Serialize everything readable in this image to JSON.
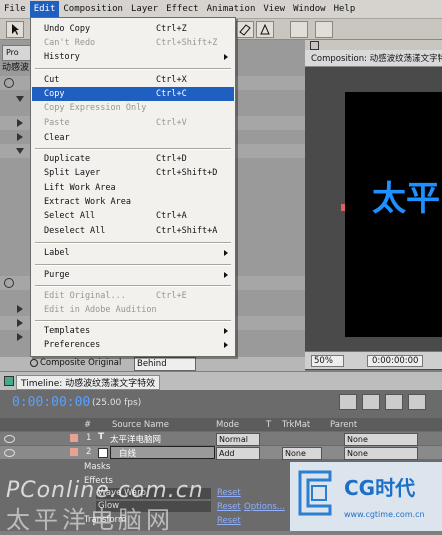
{
  "menubar": [
    "File",
    "Edit",
    "Composition",
    "Layer",
    "Effect",
    "Animation",
    "View",
    "Window",
    "Help"
  ],
  "edit_menu": [
    {
      "label": "Undo Copy",
      "shortcut": "Ctrl+Z",
      "state": "enabled"
    },
    {
      "label": "Can't Redo",
      "shortcut": "Ctrl+Shift+Z",
      "state": "disabled"
    },
    {
      "label": "History",
      "shortcut": "",
      "state": "submenu"
    },
    {
      "label": "Cut",
      "shortcut": "Ctrl+X",
      "state": "enabled"
    },
    {
      "label": "Copy",
      "shortcut": "Ctrl+C",
      "state": "highlighted"
    },
    {
      "label": "Copy Expression Only",
      "shortcut": "",
      "state": "disabled"
    },
    {
      "label": "Paste",
      "shortcut": "Ctrl+V",
      "state": "disabled"
    },
    {
      "label": "Clear",
      "shortcut": "",
      "state": "enabled"
    },
    {
      "label": "Duplicate",
      "shortcut": "Ctrl+D",
      "state": "enabled"
    },
    {
      "label": "Split Layer",
      "shortcut": "Ctrl+Shift+D",
      "state": "enabled"
    },
    {
      "label": "Lift Work Area",
      "shortcut": "",
      "state": "enabled"
    },
    {
      "label": "Extract Work Area",
      "shortcut": "",
      "state": "enabled"
    },
    {
      "label": "Select All",
      "shortcut": "Ctrl+A",
      "state": "enabled"
    },
    {
      "label": "Deselect All",
      "shortcut": "Ctrl+Shift+A",
      "state": "enabled"
    },
    {
      "label": "Label",
      "shortcut": "",
      "state": "submenu"
    },
    {
      "label": "Purge",
      "shortcut": "",
      "state": "submenu"
    },
    {
      "label": "Edit Original...",
      "shortcut": "Ctrl+E",
      "state": "disabled"
    },
    {
      "label": "Edit in Adobe Audition",
      "shortcut": "",
      "state": "disabled"
    },
    {
      "label": "Templates",
      "shortcut": "",
      "state": "submenu"
    },
    {
      "label": "Preferences",
      "shortcut": "",
      "state": "submenu"
    }
  ],
  "project_panel": {
    "tab_label": "Pro",
    "name_fragment": "动感波"
  },
  "composition": {
    "tab_title": "Composition: 动感波纹荡漾文字特效",
    "preview_text": "太平",
    "zoom": "50%",
    "timecode": "0:00:00:00"
  },
  "composite_row": {
    "label": "Composite Original",
    "mode": "Behind"
  },
  "timeline": {
    "title": "Timeline: 动感波纹荡漾文字特效",
    "timecode": "0:00:00:00",
    "fps": "(25.00 fps)",
    "columns": [
      "#",
      "Source Name",
      "Mode",
      "T",
      "TrkMat",
      "Parent"
    ],
    "layers": [
      {
        "num": "1",
        "type": "T",
        "name": "太平洋电脑网",
        "mode": "Normal",
        "trkmat": "",
        "parent": "None"
      },
      {
        "num": "2",
        "type": "",
        "name": "白线",
        "mode": "Add",
        "trkmat": "None",
        "parent": "None"
      }
    ],
    "sub_rows": [
      "Masks",
      "Effects",
      "Wave Warp",
      "Glow",
      "Transform"
    ],
    "reset_label": "Reset",
    "options_label": "Options..."
  },
  "watermark": {
    "left_en": "PConline.com.cn",
    "left_cn": "太平洋电脑网",
    "right_brand": "CG时代",
    "right_url": "www.cgtime.com.cn"
  },
  "colors": {
    "menu_highlight": "#1f5fbf",
    "timecode": "#5aa0ff",
    "preview_text": "#1e90ff",
    "link_blue": "#2a5fd0"
  }
}
